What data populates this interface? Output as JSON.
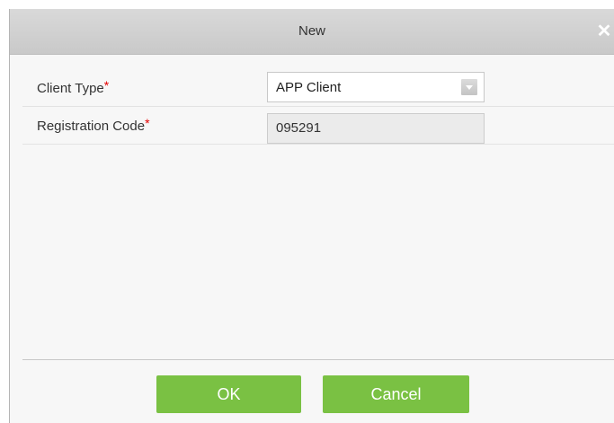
{
  "dialog": {
    "title": "New",
    "close_glyph": "✕"
  },
  "form": {
    "client_type": {
      "label": "Client Type",
      "required_mark": "*",
      "value": "APP Client"
    },
    "registration_code": {
      "label": "Registration Code",
      "required_mark": "*",
      "value": "095291"
    }
  },
  "footer": {
    "ok_label": "OK",
    "cancel_label": "Cancel"
  },
  "colors": {
    "button_green": "#7ac143",
    "required_red": "#e60000"
  },
  "icons": {
    "close": "close-icon",
    "dropdown": "chevron-down-icon"
  }
}
